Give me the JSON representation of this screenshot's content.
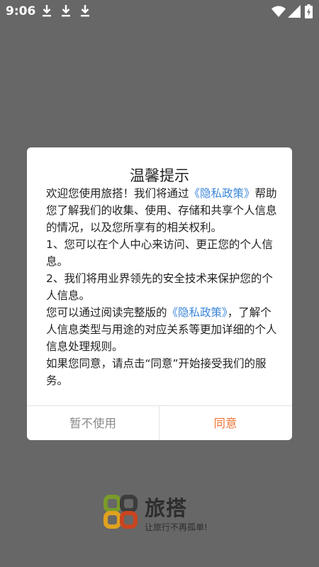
{
  "status_bar": {
    "time": "9:06",
    "download_icons": [
      "download-icon",
      "download-icon",
      "download-icon"
    ],
    "right_icons": [
      "wifi-icon",
      "signal-icon",
      "battery-charging-icon"
    ]
  },
  "dialog": {
    "title": "温馨提示",
    "body": {
      "p1_prefix": "欢迎您使用旅搭！我们将通过",
      "p1_link": "《隐私政策》",
      "p1_suffix": "帮助您了解我们的收集、使用、存储和共享个人信息的情况，以及您所享有的相关权利。",
      "p2": " 1、您可以在个人中心来访问、更正您的个人信息。",
      "p3": " 2、我们将用业界领先的安全技术来保护您的个人信息。",
      "p4_prefix": " 您可以通过阅读完整版的",
      "p4_link": "《隐私政策》",
      "p4_suffix": "，了解个人信息类型与用途的对应关系等更加详细的个人信息处理规则。",
      "p5": " 如果您同意，请点击“同意”开始接受我们的服务。"
    },
    "cancel_label": "暂不使用",
    "agree_label": "同意"
  },
  "brand": {
    "name": "旅搭",
    "slogan": "让旅行不再孤单!"
  },
  "colors": {
    "backdrop": "#676767",
    "link": "#3b86d8",
    "agree": "#ef7434",
    "cancel": "#8a8a8a"
  }
}
